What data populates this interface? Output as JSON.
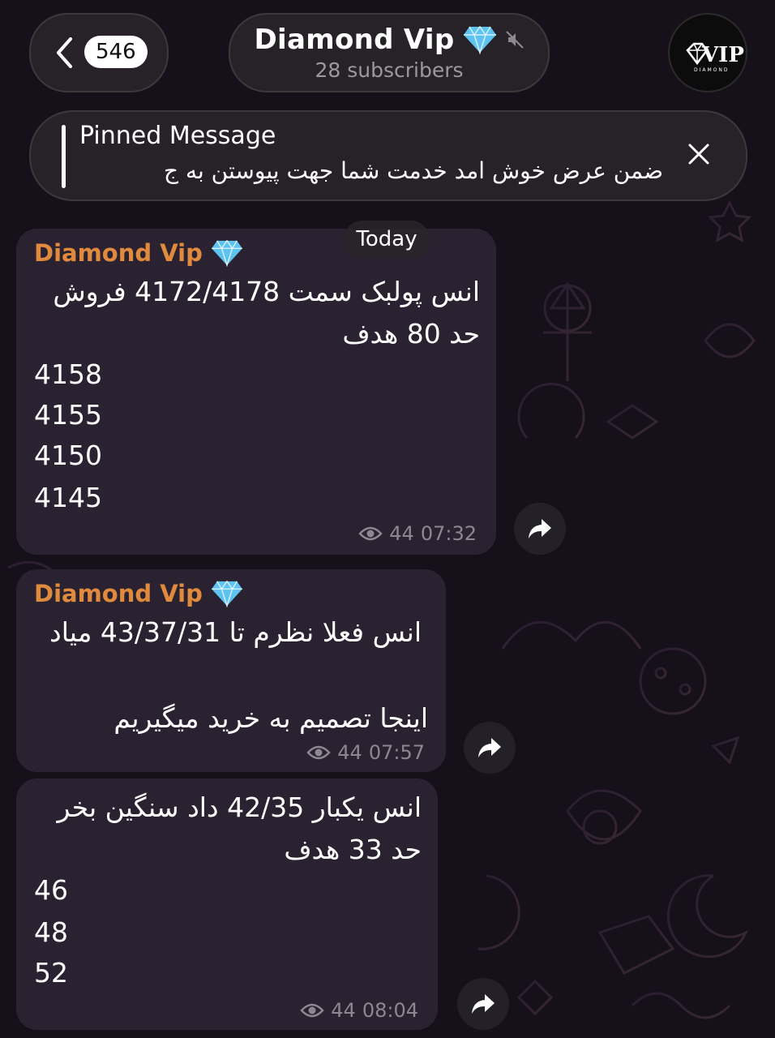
{
  "header": {
    "unread_count": "546",
    "channel_title": "Diamond Vip",
    "subscribers": "28 subscribers",
    "avatar_text": "VIP",
    "avatar_subtext": "DIAMOND"
  },
  "pinned": {
    "label": "Pinned Message",
    "text": "ضمن عرض خوش امد خدمت شما جهت پیوستن به ج"
  },
  "date_chip": "Today",
  "messages": [
    {
      "sender": "Diamond Vip",
      "lines": [
        "انس پولبک سمت 4172/4178 فروش",
        "حد 80 هدف",
        "4158",
        "4155",
        "4150",
        "4145"
      ],
      "views": "44",
      "time": "07:32"
    },
    {
      "sender": "Diamond Vip",
      "lines": [
        "انس فعلا نظرم تا 43/37/31 میاد",
        "اینجا تصمیم به خرید میگیریم"
      ],
      "views": "44",
      "time": "07:57"
    },
    {
      "lines": [
        "انس یکبار 42/35 داد سنگین بخر",
        "حد 33 هدف",
        "46",
        "48",
        "52"
      ],
      "views": "44",
      "time": "08:04"
    }
  ],
  "icons": {
    "back": "chevron-left-icon",
    "mute": "muted-speaker-icon",
    "verified": "diamond-emoji-icon",
    "close": "close-icon",
    "views": "eye-icon",
    "forward": "share-arrow-icon"
  },
  "colors": {
    "background": "#17111c",
    "bubble": "#2a2230",
    "sender": "#e08a3e",
    "meta": "#8d8790",
    "diamond": "#5fc3f2"
  }
}
